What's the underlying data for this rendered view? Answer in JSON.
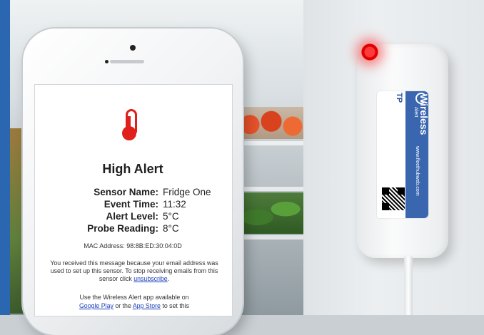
{
  "email": {
    "title": "High Alert",
    "fields": [
      {
        "label": "Sensor Name:",
        "value": "Fridge One"
      },
      {
        "label": "Event Time:",
        "value": "11:32"
      },
      {
        "label": "Alert Level:",
        "value": "5°C"
      },
      {
        "label": "Probe Reading:",
        "value": "8°C"
      }
    ],
    "mac": "MAC Address: 98:8B:ED:30:04:0D",
    "notice_before": "You received this message because your email address was used to set up this sensor. To stop receiving emails from this sensor click",
    "unsubscribe_link": "unsubscribe",
    "notice_after": ".",
    "app_prefix": "Use the Wireless Alert app available on",
    "google_play_link": "Google Play",
    "app_or": "or the",
    "app_store_link": "App Store",
    "app_suffix": "to set this"
  },
  "device": {
    "tag": "TP",
    "brand": "Wireless",
    "brand_sub": "Alert",
    "url": "www.fleethubweb.com",
    "led_color": "#ff2020"
  },
  "colors": {
    "alert_red": "#e0201a",
    "link_blue": "#1a3fb8",
    "label_blue": "#3a66b0"
  },
  "icons": {
    "thermometer": "thermometer-icon",
    "qr_code": "qr-code-icon"
  }
}
